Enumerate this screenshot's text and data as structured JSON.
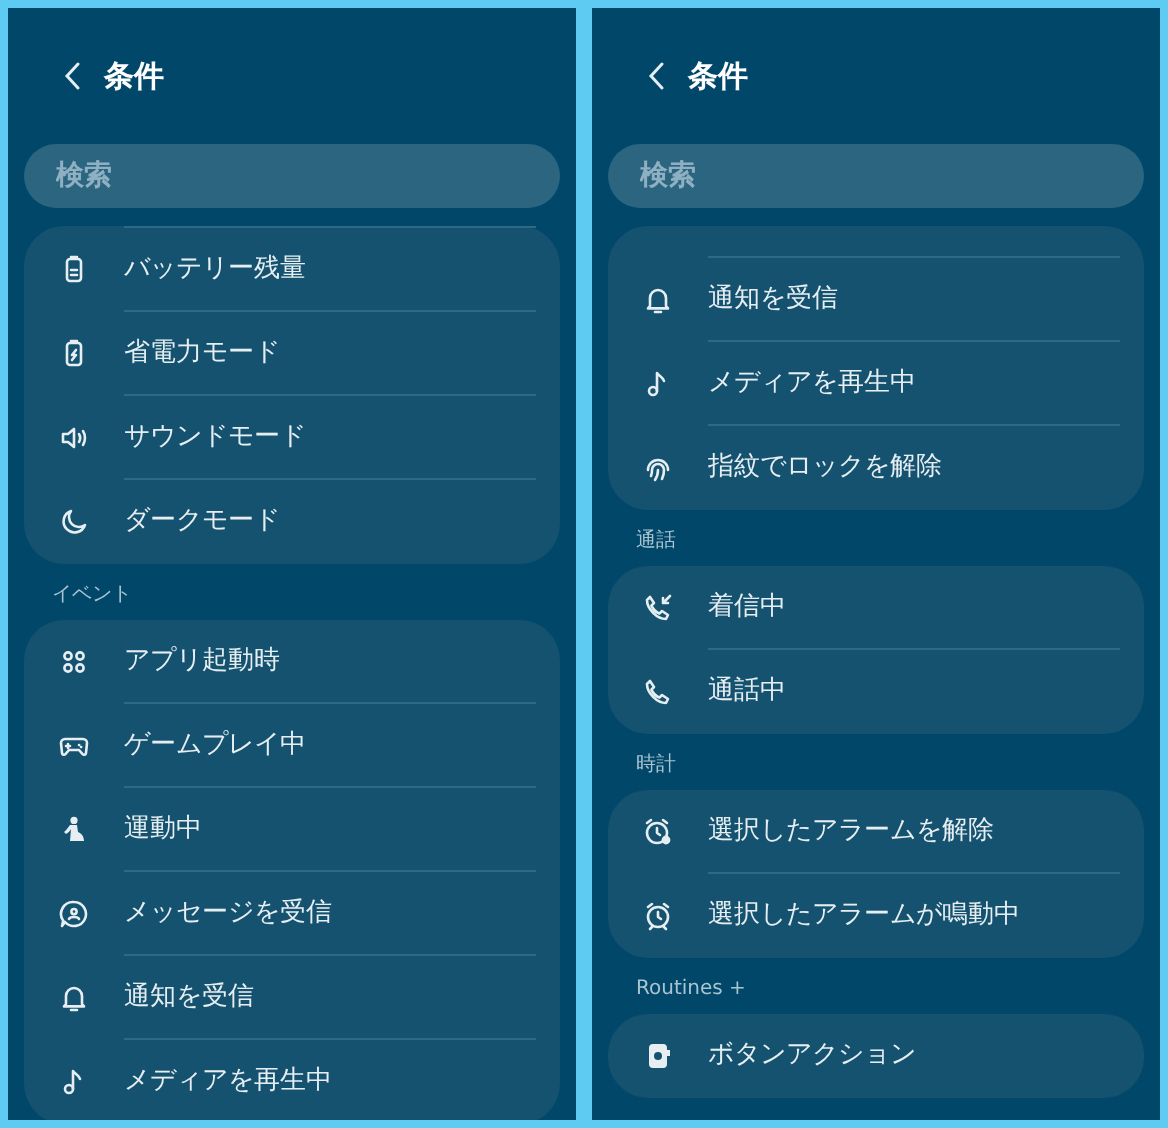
{
  "panels": [
    {
      "title": "条件",
      "search": {
        "placeholder": "検索"
      },
      "top_cut": false,
      "sections": [
        {
          "items": [
            {
              "label": "バッテリー残量"
            },
            {
              "label": "省電力モード"
            },
            {
              "label": "サウンドモード"
            },
            {
              "label": "ダークモード"
            }
          ]
        },
        {
          "heading": "イベント",
          "items": [
            {
              "label": "アプリ起動時"
            },
            {
              "label": "ゲームプレイ中"
            },
            {
              "label": "運動中"
            },
            {
              "label": "メッセージを受信"
            },
            {
              "label": "通知を受信"
            },
            {
              "label": "メディアを再生中"
            }
          ]
        }
      ]
    },
    {
      "title": "条件",
      "search": {
        "placeholder": "検索"
      },
      "top_cut": true,
      "sections": [
        {
          "items": [
            {
              "label": "通知を受信"
            },
            {
              "label": "メディアを再生中"
            },
            {
              "label": "指紋でロックを解除"
            }
          ]
        },
        {
          "heading": "通話",
          "items": [
            {
              "label": "着信中"
            },
            {
              "label": "通話中"
            }
          ]
        },
        {
          "heading": "時計",
          "items": [
            {
              "label": "選択したアラームを解除"
            },
            {
              "label": "選択したアラームが鳴動中"
            }
          ]
        },
        {
          "heading": "Routines +",
          "items": [
            {
              "label": "ボタンアクション"
            }
          ]
        }
      ]
    }
  ]
}
